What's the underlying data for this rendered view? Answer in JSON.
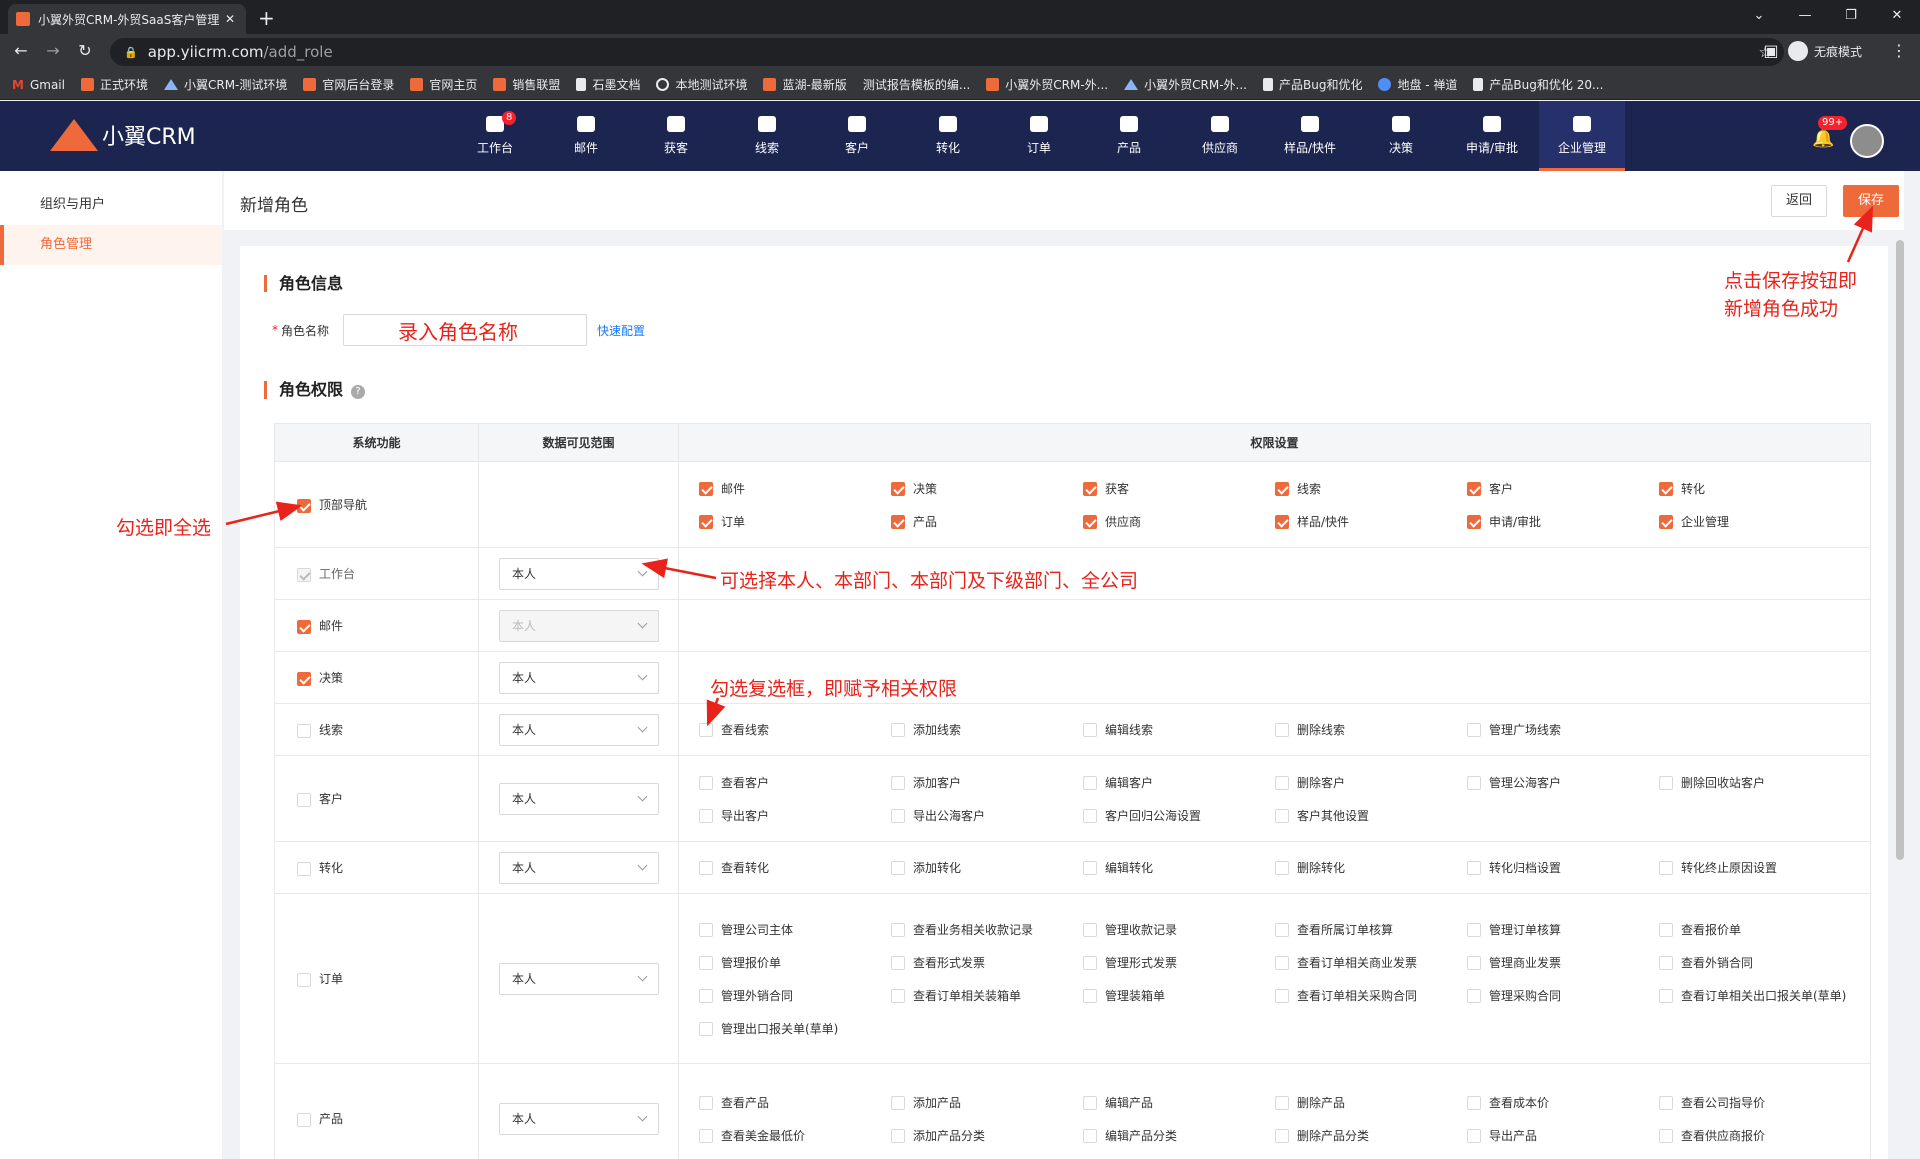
{
  "browser": {
    "tab_title": "小翼外贸CRM-外贸SaaS客户管理",
    "url_host": "app.yiicrm.com",
    "url_path": "/add_role",
    "incognito_label": "无痕模式",
    "bookmarks": [
      {
        "label": "Gmail",
        "icon": "gmail-icon"
      },
      {
        "label": "正式环境",
        "icon": "crm-icon"
      },
      {
        "label": "小翼CRM-测试环境",
        "icon": "triangle-icon"
      },
      {
        "label": "官网后台登录",
        "icon": "crm-icon"
      },
      {
        "label": "官网主页",
        "icon": "crm-icon"
      },
      {
        "label": "销售联盟",
        "icon": "crm-icon"
      },
      {
        "label": "石墨文档",
        "icon": "doc-icon"
      },
      {
        "label": "本地测试环境",
        "icon": "globe-icon"
      },
      {
        "label": "蓝湖-最新版",
        "icon": "crm-icon"
      },
      {
        "label": "测试报告模板的编...",
        "icon": "none"
      },
      {
        "label": "小翼外贸CRM-外...",
        "icon": "crm-icon"
      },
      {
        "label": "小翼外贸CRM-外...",
        "icon": "triangle-icon"
      },
      {
        "label": "产品Bug和优化",
        "icon": "doc-icon"
      },
      {
        "label": "地盘 - 禅道",
        "icon": "blue-icon"
      },
      {
        "label": "产品Bug和优化 20...",
        "icon": "doc-icon"
      }
    ]
  },
  "app": {
    "logo_text": "小翼CRM",
    "nav": [
      {
        "label": "工作台",
        "badge": "8"
      },
      {
        "label": "邮件"
      },
      {
        "label": "获客"
      },
      {
        "label": "线索"
      },
      {
        "label": "客户"
      },
      {
        "label": "转化"
      },
      {
        "label": "订单"
      },
      {
        "label": "产品"
      },
      {
        "label": "供应商"
      },
      {
        "label": "样品/快件"
      },
      {
        "label": "决策"
      },
      {
        "label": "申请/审批"
      },
      {
        "label": "企业管理",
        "active": true
      }
    ],
    "notify_badge": "99+"
  },
  "sidebar": {
    "items": [
      {
        "label": "组织与用户"
      },
      {
        "label": "角色管理",
        "active": true
      }
    ]
  },
  "page": {
    "title": "新增角色",
    "back_label": "返回",
    "save_label": "保存",
    "role_info_title": "角色信息",
    "role_name_label": "角色名称",
    "role_name_value": "",
    "quick_config": "快速配置",
    "perm_title": "角色权限",
    "help_glyph": "?"
  },
  "table": {
    "headers": [
      "系统功能",
      "数据可见范围",
      "权限设置"
    ],
    "rows": [
      {
        "name": "顶部导航",
        "checked": true,
        "scope": null,
        "perms": [
          {
            "label": "邮件",
            "on": true
          },
          {
            "label": "决策",
            "on": true
          },
          {
            "label": "获客",
            "on": true
          },
          {
            "label": "线索",
            "on": true
          },
          {
            "label": "客户",
            "on": true
          },
          {
            "label": "转化",
            "on": true
          },
          {
            "label": "订单",
            "on": true
          },
          {
            "label": "产品",
            "on": true
          },
          {
            "label": "供应商",
            "on": true
          },
          {
            "label": "样品/快件",
            "on": true
          },
          {
            "label": "申请/审批",
            "on": true
          },
          {
            "label": "企业管理",
            "on": true
          }
        ]
      },
      {
        "name": "工作台",
        "checked": "disabled",
        "scope": "本人",
        "perms": []
      },
      {
        "name": "邮件",
        "checked": true,
        "scope": "本人",
        "scope_disabled": true,
        "perms": []
      },
      {
        "name": "决策",
        "checked": true,
        "scope": "本人",
        "perms": []
      },
      {
        "name": "线索",
        "checked": false,
        "scope": "本人",
        "perms": [
          {
            "label": "查看线索"
          },
          {
            "label": "添加线索"
          },
          {
            "label": "编辑线索"
          },
          {
            "label": "删除线索"
          },
          {
            "label": "管理广场线索"
          }
        ]
      },
      {
        "name": "客户",
        "checked": false,
        "scope": "本人",
        "perms": [
          {
            "label": "查看客户"
          },
          {
            "label": "添加客户"
          },
          {
            "label": "编辑客户"
          },
          {
            "label": "删除客户"
          },
          {
            "label": "管理公海客户"
          },
          {
            "label": "删除回收站客户"
          },
          {
            "label": "导出客户"
          },
          {
            "label": "导出公海客户"
          },
          {
            "label": "客户回归公海设置"
          },
          {
            "label": "客户其他设置"
          }
        ]
      },
      {
        "name": "转化",
        "checked": false,
        "scope": "本人",
        "perms": [
          {
            "label": "查看转化"
          },
          {
            "label": "添加转化"
          },
          {
            "label": "编辑转化"
          },
          {
            "label": "删除转化"
          },
          {
            "label": "转化归档设置"
          },
          {
            "label": "转化终止原因设置"
          }
        ]
      },
      {
        "name": "订单",
        "checked": false,
        "scope": "本人",
        "perms": [
          {
            "label": "管理公司主体"
          },
          {
            "label": "查看业务相关收款记录"
          },
          {
            "label": "管理收款记录"
          },
          {
            "label": "查看所属订单核算"
          },
          {
            "label": "管理订单核算"
          },
          {
            "label": "查看报价单"
          },
          {
            "label": "管理报价单"
          },
          {
            "label": "查看形式发票"
          },
          {
            "label": "管理形式发票"
          },
          {
            "label": "查看订单相关商业发票"
          },
          {
            "label": "管理商业发票"
          },
          {
            "label": "查看外销合同"
          },
          {
            "label": "管理外销合同"
          },
          {
            "label": "查看订单相关装箱单"
          },
          {
            "label": "管理装箱单"
          },
          {
            "label": "查看订单相关采购合同"
          },
          {
            "label": "管理采购合同"
          },
          {
            "label": "查看订单相关出口报关单(草单)"
          },
          {
            "label": "管理出口报关单(草单)"
          }
        ]
      },
      {
        "name": "产品",
        "checked": false,
        "scope": "本人",
        "perms": [
          {
            "label": "查看产品"
          },
          {
            "label": "添加产品"
          },
          {
            "label": "编辑产品"
          },
          {
            "label": "删除产品"
          },
          {
            "label": "查看成本价"
          },
          {
            "label": "查看公司指导价"
          },
          {
            "label": "查看美金最低价"
          },
          {
            "label": "添加产品分类"
          },
          {
            "label": "编辑产品分类"
          },
          {
            "label": "删除产品分类"
          },
          {
            "label": "导出产品"
          },
          {
            "label": "查看供应商报价"
          }
        ]
      }
    ]
  },
  "annotations": {
    "role_name_hint": "录入角色名称",
    "save_hint_line1": "点击保存按钮即",
    "save_hint_line2": "新增角色成功",
    "select_all_hint": "勾选即全选",
    "scope_hint": "可选择本人、本部门、本部门及下级部门、全公司",
    "checkbox_hint": "勾选复选框，即赋予相关权限"
  }
}
